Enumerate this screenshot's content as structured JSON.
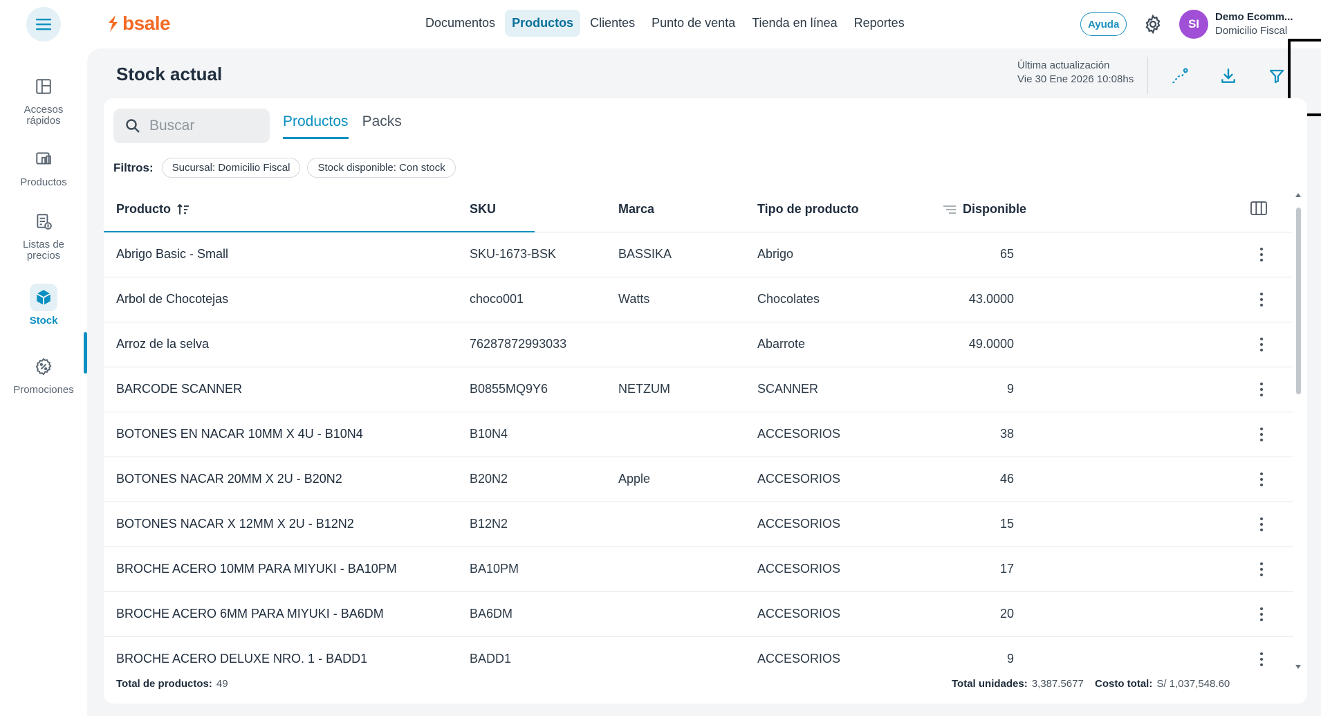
{
  "topbar": {
    "logo_text": "bsale",
    "nav": [
      "Documentos",
      "Productos",
      "Clientes",
      "Punto de venta",
      "Tienda en línea",
      "Reportes"
    ],
    "active_nav": "Productos",
    "help_label": "Ayuda",
    "user_initials": "SI",
    "user_name": "Demo Ecomm...",
    "user_branch": "Domicilio Fiscal"
  },
  "sidebar": {
    "items": [
      {
        "label": "Accesos rápidos",
        "icon": "layout-icon"
      },
      {
        "label": "Productos",
        "icon": "products-icon"
      },
      {
        "label": "Listas de precios",
        "icon": "price-list-icon"
      },
      {
        "label": "Stock",
        "icon": "cube-icon"
      },
      {
        "label": "Promociones",
        "icon": "promo-icon"
      }
    ],
    "active": "Stock"
  },
  "page": {
    "title": "Stock actual",
    "update_label": "Última actualización",
    "update_value": "Vie 30 Ene 2026 10:08hs"
  },
  "search": {
    "placeholder": "Buscar"
  },
  "tabs": [
    "Productos",
    "Packs"
  ],
  "filters": {
    "label": "Filtros:",
    "chips": [
      "Sucursal: Domicilio Fiscal",
      "Stock disponible: Con stock"
    ]
  },
  "table": {
    "columns": [
      "Producto",
      "SKU",
      "Marca",
      "Tipo de producto",
      "Disponible"
    ],
    "rows": [
      {
        "producto": "Abrigo Basic - Small",
        "sku": "SKU-1673-BSK",
        "marca": "BASSIKA",
        "tipo": "Abrigo",
        "disponible": "65"
      },
      {
        "producto": "Arbol de Chocotejas",
        "sku": "choco001",
        "marca": "Watts",
        "tipo": "Chocolates",
        "disponible": "43.0000"
      },
      {
        "producto": "Arroz de la selva",
        "sku": "76287872993033",
        "marca": "",
        "tipo": "Abarrote",
        "disponible": "49.0000"
      },
      {
        "producto": "BARCODE SCANNER",
        "sku": "B0855MQ9Y6",
        "marca": "NETZUM",
        "tipo": "SCANNER",
        "disponible": "9"
      },
      {
        "producto": "BOTONES EN NACAR 10MM X 4U - B10N4",
        "sku": "B10N4",
        "marca": "",
        "tipo": "ACCESORIOS",
        "disponible": "38"
      },
      {
        "producto": "BOTONES NACAR 20MM X 2U - B20N2",
        "sku": "B20N2",
        "marca": "Apple",
        "tipo": "ACCESORIOS",
        "disponible": "46"
      },
      {
        "producto": "BOTONES NACAR X 12MM X 2U - B12N2",
        "sku": "B12N2",
        "marca": "",
        "tipo": "ACCESORIOS",
        "disponible": "15"
      },
      {
        "producto": "BROCHE ACERO 10MM PARA MIYUKI - BA10PM",
        "sku": "BA10PM",
        "marca": "",
        "tipo": "ACCESORIOS",
        "disponible": "17"
      },
      {
        "producto": "BROCHE ACERO 6MM PARA MIYUKI - BA6DM",
        "sku": "BA6DM",
        "marca": "",
        "tipo": "ACCESORIOS",
        "disponible": "20"
      },
      {
        "producto": "BROCHE ACERO DELUXE NRO. 1 - BADD1",
        "sku": "BADD1",
        "marca": "",
        "tipo": "ACCESORIOS",
        "disponible": "9"
      }
    ]
  },
  "footer": {
    "total_productos_label": "Total de productos:",
    "total_productos": "49",
    "total_unidades_label": "Total unidades:",
    "total_unidades": "3,387.5677",
    "costo_total_label": "Costo total:",
    "costo_total": "S/ 1,037,548.60"
  },
  "colors": {
    "accent": "#0b8fc0",
    "brand": "#f36a24",
    "avatar": "#a04fd6"
  }
}
